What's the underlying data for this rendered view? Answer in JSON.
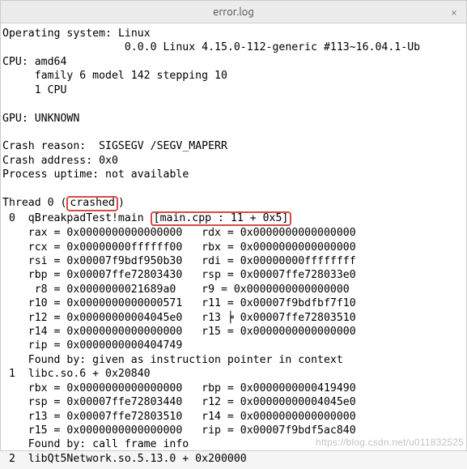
{
  "titlebar": {
    "filename": "error.log",
    "close_symbol": "×"
  },
  "log": {
    "os_label": "Operating system:",
    "os_value": "Linux",
    "os_detail": "                   0.0.0 Linux 4.15.0-112-generic #113~16.04.1-Ub",
    "cpu_label": "CPU:",
    "cpu_value": "amd64",
    "cpu_detail1": "     family 6 model 142 stepping 10",
    "cpu_detail2": "     1 CPU",
    "gpu_label": "GPU:",
    "gpu_value": "UNKNOWN",
    "crash_reason_label": "Crash reason:",
    "crash_reason_value": " SIGSEGV /SEGV_MAPERR",
    "crash_address_label": "Crash address:",
    "crash_address_value": "0x0",
    "uptime_label": "Process uptime:",
    "uptime_value": "not available",
    "thread_line_prefix": "Thread 0 (",
    "thread_crashed": "crashed",
    "thread_line_suffix": ")",
    "frame0_index": " 0  ",
    "frame0_module": "qBreakpadTest!main ",
    "frame0_location": "[main.cpp : 11 + 0x5]",
    "reg_rax": "    rax = 0x0000000000000000   rdx = 0x0000000000000000",
    "reg_rcx": "    rcx = 0x00000000ffffff00   rbx = 0x0000000000000000",
    "reg_rsi": "    rsi = 0x00007f9bdf950b30   rdi = 0x00000000ffffffff",
    "reg_rbp": "    rbp = 0x00007ffe72803430   rsp = 0x00007ffe728033e0",
    "reg_r8": "     r8 = 0x0000000021689a0    r9 = 0x0000000000000000",
    "reg_r10": "    r10 = 0x0000000000000571   r11 = 0x00007f9bdfbf7f10",
    "reg_r12": "    r12 = 0x00000000004045e0   r13 ╞ 0x00007ffe72803510",
    "reg_r14": "    r14 = 0x0000000000000000   r15 = 0x0000000000000000",
    "reg_rip": "    rip = 0x0000000000404749",
    "found0": "    Found by: given as instruction pointer in context",
    "frame1": " 1  libc.so.6 + 0x20840",
    "reg1_rbx": "    rbx = 0x0000000000000000   rbp = 0x0000000000419490",
    "reg1_rsp": "    rsp = 0x00007ffe72803440   r12 = 0x00000000004045e0",
    "reg1_r13": "    r13 = 0x00007ffe72803510   r14 = 0x0000000000000000",
    "reg1_r15": "    r15 = 0x0000000000000000   rip = 0x00007f9bdf5ac840",
    "found1": "    Found by: call frame info",
    "frame2": " 2  libQt5Network.so.5.13.0 + 0x200000"
  },
  "watermark": "https://blog.csdn.net/u011832525"
}
